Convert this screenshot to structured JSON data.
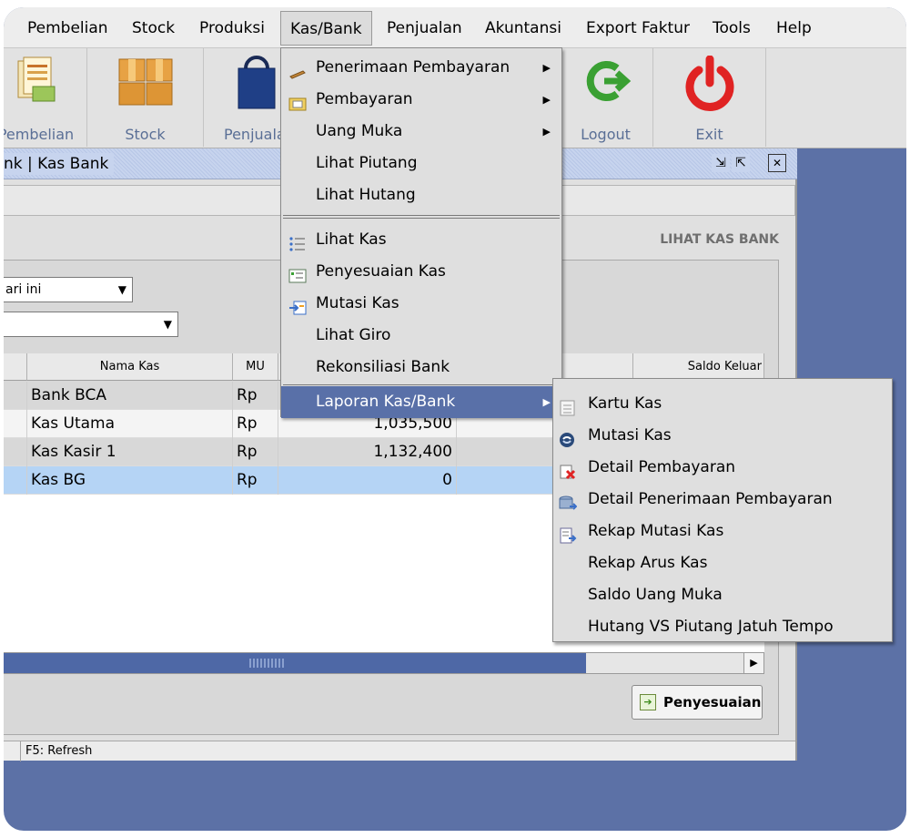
{
  "menubar": {
    "items": [
      "Pembelian",
      "Stock",
      "Produksi",
      "Kas/Bank",
      "Penjualan",
      "Akuntansi",
      "Export Faktur",
      "Tools",
      "Help"
    ]
  },
  "toolbar": {
    "buttons": [
      "Pembelian",
      "Stock",
      "Penjualan",
      "Logout",
      "Exit"
    ]
  },
  "window": {
    "title": "nk | Kas Bank",
    "section_title": "LIHAT KAS BANK",
    "filter_period": "ari ini",
    "filter_second": ""
  },
  "grid": {
    "columns": [
      "Nama Kas",
      "MU",
      "Saldo Keluar"
    ],
    "rows": [
      {
        "nama": "Bank BCA",
        "mu": "Rp",
        "saldo": ""
      },
      {
        "nama": "Kas Utama",
        "mu": "Rp",
        "saldo": "1,035,500"
      },
      {
        "nama": "Kas Kasir 1",
        "mu": "Rp",
        "saldo": "1,132,400"
      },
      {
        "nama": "Kas BG",
        "mu": "Rp",
        "saldo": "0"
      }
    ]
  },
  "buttons": {
    "penyesuaian": "Penyesuaian"
  },
  "statusbar": {
    "text": "F5: Refresh"
  },
  "kas_menu": {
    "items": [
      "Penerimaan Pembayaran",
      "Pembayaran",
      "Uang Muka",
      "Lihat Piutang",
      "Lihat Hutang",
      "Lihat Kas",
      "Penyesuaian Kas",
      "Mutasi Kas",
      "Lihat Giro",
      "Rekonsiliasi Bank",
      "Laporan Kas/Bank"
    ]
  },
  "laporan_menu": {
    "items": [
      "Kartu Kas",
      "Mutasi Kas",
      "Detail Pembayaran",
      "Detail Penerimaan Pembayaran",
      "Rekap Mutasi Kas",
      "Rekap Arus Kas",
      "Saldo Uang Muka",
      "Hutang VS Piutang Jatuh Tempo"
    ]
  },
  "colors": {
    "desktop": "#5c71a6",
    "menu_highlight": "#5970a8",
    "row_selected": "#b5d4f5",
    "toolbar_label": "#5a6f96"
  }
}
